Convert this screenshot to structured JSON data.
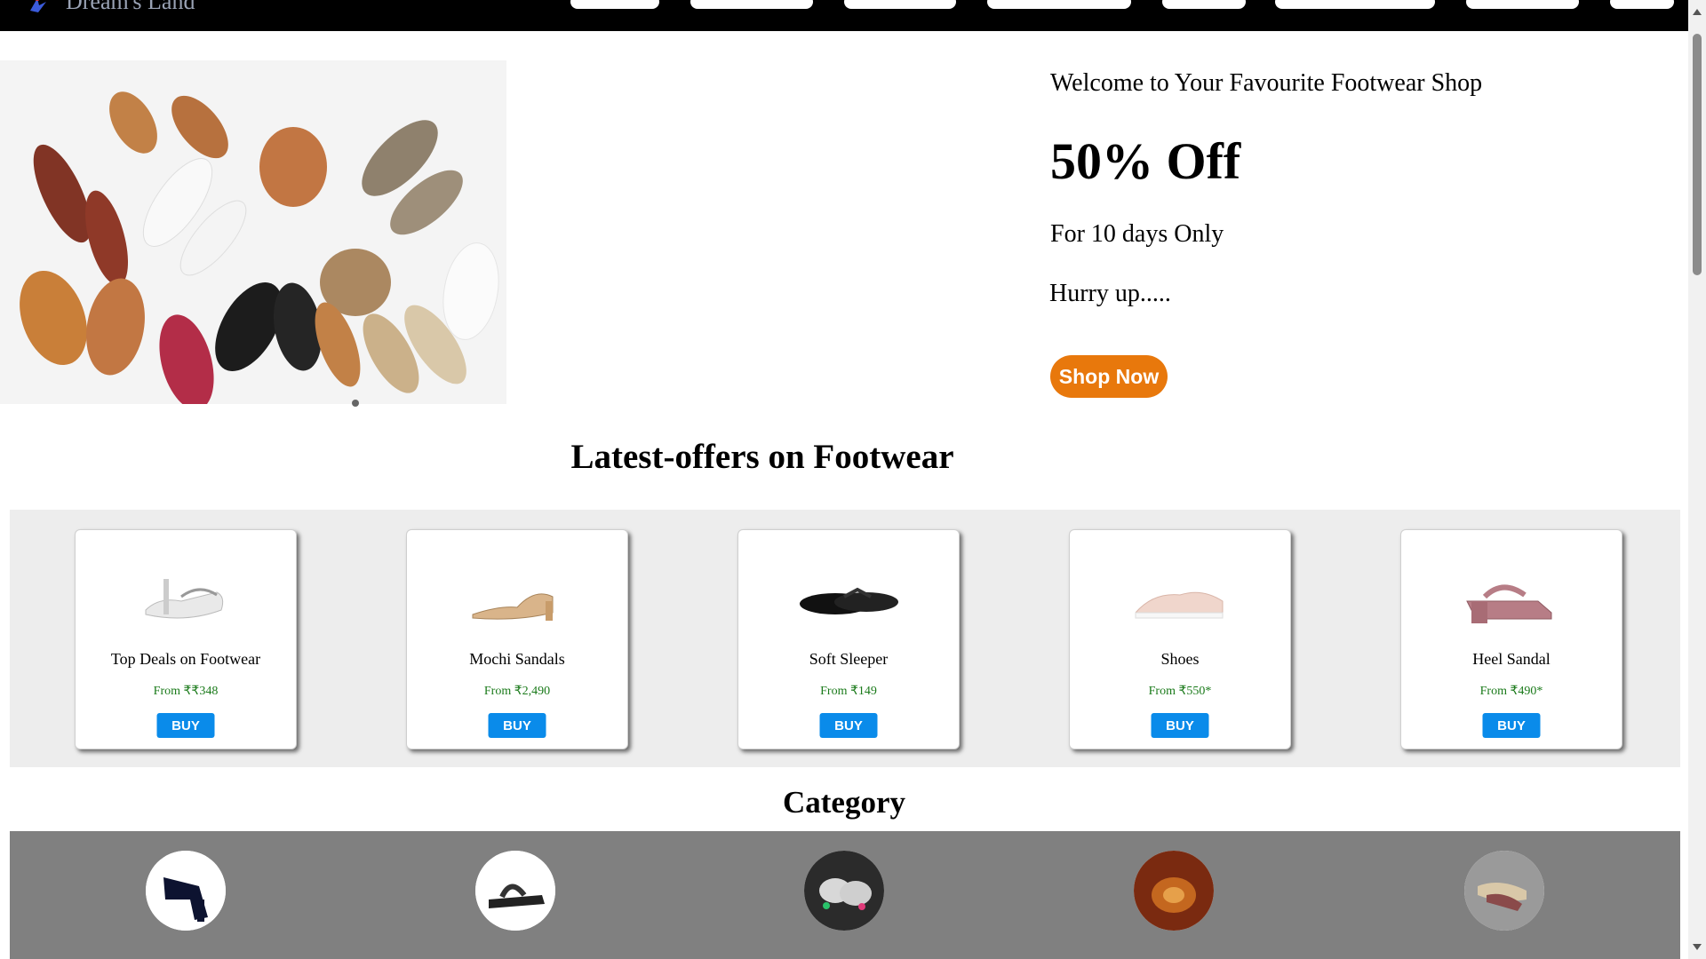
{
  "brand": {
    "name": "Dream's Land"
  },
  "hero": {
    "welcome": "Welcome to Your Favourite Footwear Shop",
    "discount": "50% Off",
    "duration": "For 10 days Only",
    "urgency": "Hurry up.....",
    "cta_label": "Shop Now"
  },
  "offers": {
    "title": "Latest-offers on Footwear",
    "buy_label": "BUY",
    "items": [
      {
        "name": "Top Deals on Footwear",
        "price": "From ₹₹348"
      },
      {
        "name": "Mochi Sandals",
        "price": "From ₹2,490"
      },
      {
        "name": "Soft Sleeper",
        "price": "From ₹149"
      },
      {
        "name": "Shoes",
        "price": "From ₹550*"
      },
      {
        "name": "Heel Sandal",
        "price": "From ₹490*"
      }
    ]
  },
  "category": {
    "title": "Category"
  },
  "colors": {
    "nav": "#000000",
    "cta": "#e8780c",
    "buy": "#0a8bea",
    "price": "#1a7a1a",
    "offers_band": "#ededed",
    "category_band": "#808080"
  }
}
